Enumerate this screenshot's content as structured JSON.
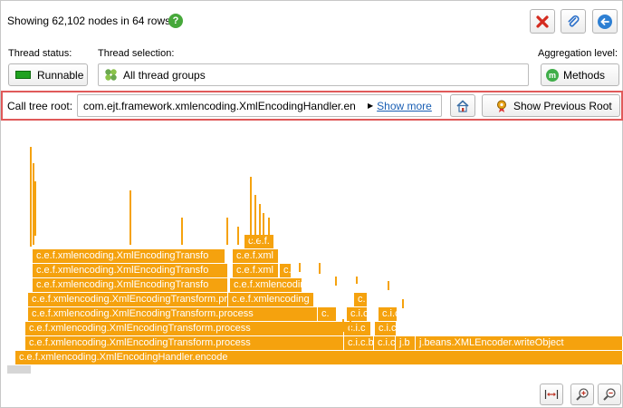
{
  "summary": {
    "text": "Showing 62,102 nodes in 64 rows"
  },
  "icons": {
    "help": "help-icon",
    "delete": "delete-icon",
    "attach": "paperclip-icon",
    "back": "back-arrow-icon"
  },
  "thread_status": {
    "label": "Thread status:",
    "value": "Runnable",
    "indicator_color": "#1fa11f"
  },
  "thread_selection": {
    "label": "Thread selection:",
    "value": "All thread groups"
  },
  "aggregation": {
    "label": "Aggregation level:",
    "value": "Methods",
    "badge": "m"
  },
  "call_tree_root": {
    "label": "Call tree root:",
    "value": "com.ejt.framework.xmlencoding.XmlEncodingHandler.en",
    "show_more": "Show more",
    "home_icon": "home-icon",
    "previous_button": "Show Previous Root"
  },
  "flame": {
    "color": "#f5a20e",
    "rows": [
      [
        {
          "label": "c.e.f.xmlencoding.XmlEncodingHandler.encode"
        }
      ],
      [
        {
          "label": "c.e.f.xmlencoding.XmlEncodingTransform.process"
        },
        {
          "label": "c.i.c.b"
        },
        {
          "label": "c.i.c.b"
        },
        {
          "label": "j.b"
        },
        {
          "label": "j.beans.XMLEncoder.writeObject"
        }
      ],
      [
        {
          "label": "c.e.f.xmlencoding.XmlEncodingTransform.process"
        },
        {
          "label": "c.i.c"
        },
        {
          "label": "c.i.c"
        }
      ],
      [
        {
          "label": "c.e.f.xmlencoding.XmlEncodingTransform.process"
        },
        {
          "label": "c."
        },
        {
          "label": "c.i.c."
        },
        {
          "label": "c.i.c"
        }
      ],
      [
        {
          "label": "c.e.f.xmlencoding.XmlEncodingTransform.process"
        },
        {
          "label": "c.e.f.xmlencoding"
        },
        {
          "label": "c."
        }
      ],
      [
        {
          "label": "c.e.f.xmlencoding.XmlEncodingTransfo"
        },
        {
          "label": "c.e.f.xmlencoding."
        }
      ],
      [
        {
          "label": "c.e.f.xmlencoding.XmlEncodingTransfo"
        },
        {
          "label": "c.e.f.xml"
        },
        {
          "label": "c."
        }
      ],
      [
        {
          "label": "c.e.f.xmlencoding.XmlEncodingTransfo"
        },
        {
          "label": "c.e.f.xml"
        }
      ],
      [
        {
          "label": "c.e.f."
        }
      ]
    ]
  },
  "zoom": {
    "fit_icon": "fit-width-icon",
    "zoom_in_icon": "zoom-in-icon",
    "zoom_out_icon": "zoom-out-icon"
  }
}
